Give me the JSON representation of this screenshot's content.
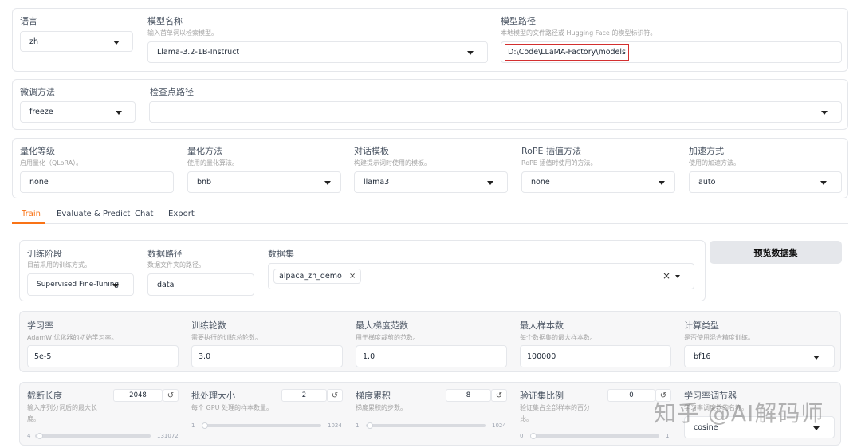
{
  "top": {
    "lang": {
      "label": "语言",
      "value": "zh"
    },
    "model_name": {
      "label": "模型名称",
      "desc": "输入首单词以检索模型。",
      "value": "Llama-3.2-1B-Instruct"
    },
    "model_path": {
      "label": "模型路径",
      "desc": "本地模型的文件路径或 Hugging Face 的模型标识符。",
      "value": "D:\\Code\\LLaMA-Factory\\models"
    }
  },
  "row2": {
    "finetune": {
      "label": "微调方法",
      "value": "freeze"
    },
    "checkpoint": {
      "label": "检查点路径",
      "value": ""
    }
  },
  "row3": {
    "quant_bit": {
      "label": "量化等级",
      "desc": "启用量化（QLoRA）。",
      "value": "none"
    },
    "quant_method": {
      "label": "量化方法",
      "desc": "使用的量化算法。",
      "value": "bnb"
    },
    "template": {
      "label": "对话模板",
      "desc": "构建提示词时使用的模板。",
      "value": "llama3"
    },
    "rope": {
      "label": "RoPE 插值方法",
      "desc": "RoPE 插值时使用的方法。",
      "value": "none"
    },
    "booster": {
      "label": "加速方式",
      "desc": "使用的加速方法。",
      "value": "auto"
    }
  },
  "tabs": [
    "Train",
    "Evaluate & Predict",
    "Chat",
    "Export"
  ],
  "active_tab": "Train",
  "train": {
    "stage": {
      "label": "训练阶段",
      "desc": "目前采用的训练方式。",
      "value": "Supervised Fine-Tuning"
    },
    "dataset_dir": {
      "label": "数据路径",
      "desc": "数据文件夹的路径。",
      "value": "data"
    },
    "dataset": {
      "label": "数据集",
      "chip": "alpaca_zh_demo",
      "chip_remove": "×",
      "clear": "×"
    },
    "preview_button": "预览数据集"
  },
  "row5": {
    "lr": {
      "label": "学习率",
      "desc": "AdamW 优化器的初始学习率。",
      "value": "5e-5"
    },
    "epochs": {
      "label": "训练轮数",
      "desc": "需要执行的训练总轮数。",
      "value": "3.0"
    },
    "max_grad_norm": {
      "label": "最大梯度范数",
      "desc": "用于梯度裁剪的范数。",
      "value": "1.0"
    },
    "max_samples": {
      "label": "最大样本数",
      "desc": "每个数据集的最大样本数。",
      "value": "100000"
    },
    "compute_type": {
      "label": "计算类型",
      "desc": "是否使用混合精度训练。",
      "value": "bf16"
    }
  },
  "row6": {
    "cutoff": {
      "label": "截断长度",
      "desc1": "输入序列分词后的最大长",
      "desc2": "度。",
      "value": "2048",
      "min": "4",
      "max": "131072",
      "fraction": 0.016
    },
    "batch": {
      "label": "批处理大小",
      "desc": "每个 GPU 处理的样本数量。",
      "value": "2",
      "min": "1",
      "max": "1024",
      "fraction": 0.001
    },
    "grad_accum": {
      "label": "梯度累积",
      "desc": "梯度累积的步数。",
      "value": "8",
      "min": "1",
      "max": "1024",
      "fraction": 0.007
    },
    "val_size": {
      "label": "验证集比例",
      "desc1": "验证集占全部样本的百分",
      "desc2": "比。",
      "value": "0",
      "min": "0",
      "max": "1",
      "fraction": 0
    },
    "scheduler": {
      "label": "学习率调节器",
      "desc": "学习率调度器的名称。",
      "value": "cosine"
    }
  },
  "reset_icon": "↺",
  "watermark": "知乎 @AI解码师",
  "colors": {
    "accent": "#f97316",
    "highlight_border": "#d32f2f",
    "button_bg": "#e5e7eb"
  }
}
